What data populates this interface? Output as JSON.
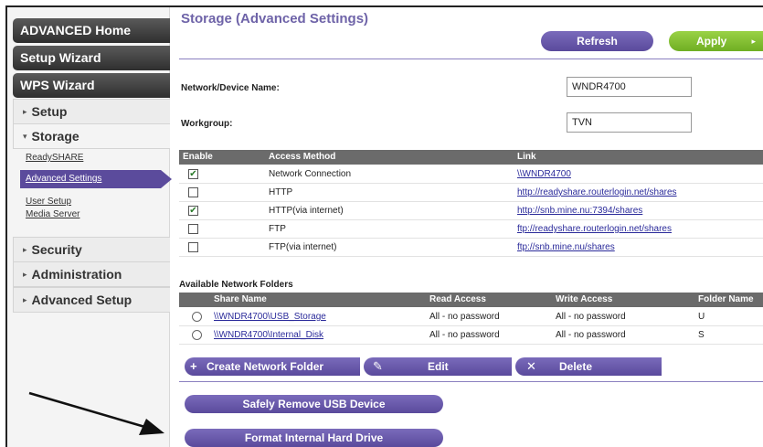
{
  "sidebar": {
    "headers": [
      "ADVANCED Home",
      "Setup Wizard",
      "WPS Wizard"
    ],
    "menus": {
      "setup": "Setup",
      "storage": "Storage",
      "security": "Security",
      "administration": "Administration",
      "advanced_setup": "Advanced Setup"
    },
    "storage_links": {
      "readyshare": "ReadySHARE",
      "advanced_settings": "Advanced Settings",
      "user_setup": "User Setup",
      "media_server": "Media Server"
    }
  },
  "page": {
    "title": "Storage (Advanced Settings)",
    "refresh_label": "Refresh",
    "apply_label": "Apply",
    "device_name_label": "Network/Device Name:",
    "device_name_value": "WNDR4700",
    "workgroup_label": "Workgroup:",
    "workgroup_value": "TVN"
  },
  "access_table": {
    "headers": {
      "enable": "Enable",
      "method": "Access Method",
      "link": "Link"
    },
    "rows": [
      {
        "checked": true,
        "method": "Network Connection",
        "link": "\\\\WNDR4700"
      },
      {
        "checked": false,
        "method": "HTTP",
        "link": "http://readyshare.routerlogin.net/shares"
      },
      {
        "checked": true,
        "method": "HTTP(via internet)",
        "link": "http://snb.mine.nu:7394/shares"
      },
      {
        "checked": false,
        "method": "FTP",
        "link": "ftp://readyshare.routerlogin.net/shares"
      },
      {
        "checked": false,
        "method": "FTP(via internet)",
        "link": "ftp://snb.mine.nu/shares"
      }
    ]
  },
  "folders": {
    "section_label": "Available Network Folders",
    "headers": {
      "share_name": "Share Name",
      "read_access": "Read Access",
      "write_access": "Write Access",
      "folder_name": "Folder Name"
    },
    "rows": [
      {
        "share": "\\\\WNDR4700\\USB_Storage",
        "read": "All - no password",
        "write": "All - no password",
        "folder": "U"
      },
      {
        "share": "\\\\WNDR4700\\Internal_Disk",
        "read": "All - no password",
        "write": "All - no password",
        "folder": "S"
      }
    ],
    "create_label": "Create Network Folder",
    "edit_label": "Edit",
    "delete_label": "Delete"
  },
  "actions": {
    "safely_remove_label": "Safely Remove USB Device",
    "format_label": "Format Internal Hard Drive"
  },
  "colors": {
    "accent_purple": "#5a4a9c",
    "apply_green": "#7fbf2a",
    "header_dark": "#3a3a3a"
  }
}
